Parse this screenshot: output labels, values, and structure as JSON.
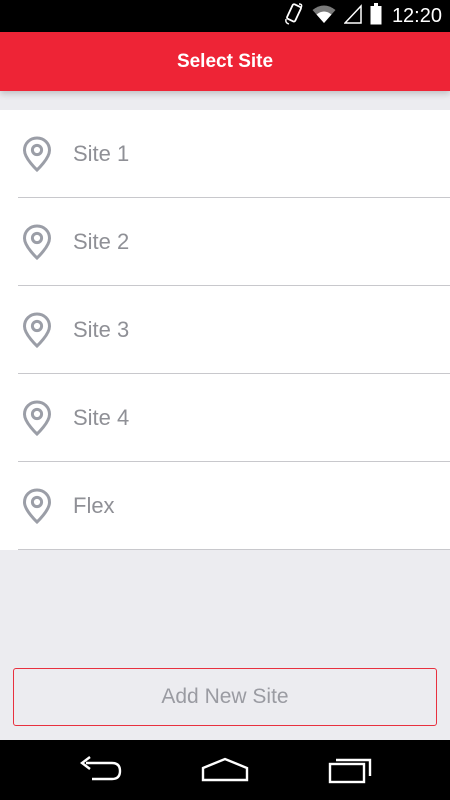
{
  "status_bar": {
    "time": "12:20",
    "icons": [
      "rotate-icon",
      "wifi-icon",
      "signal-icon",
      "battery-icon"
    ]
  },
  "header": {
    "title": "Select Site",
    "color": "#ee2436"
  },
  "sites": [
    {
      "label": "Site 1",
      "icon": "location-pin-icon"
    },
    {
      "label": "Site 2",
      "icon": "location-pin-icon"
    },
    {
      "label": "Site 3",
      "icon": "location-pin-icon"
    },
    {
      "label": "Site 4",
      "icon": "location-pin-icon"
    },
    {
      "label": "Flex",
      "icon": "location-pin-icon"
    }
  ],
  "add_button": {
    "label": "Add New Site",
    "border_color": "#e8303f"
  },
  "nav_bar": {
    "buttons": [
      "back-icon",
      "home-icon",
      "recents-icon"
    ]
  }
}
